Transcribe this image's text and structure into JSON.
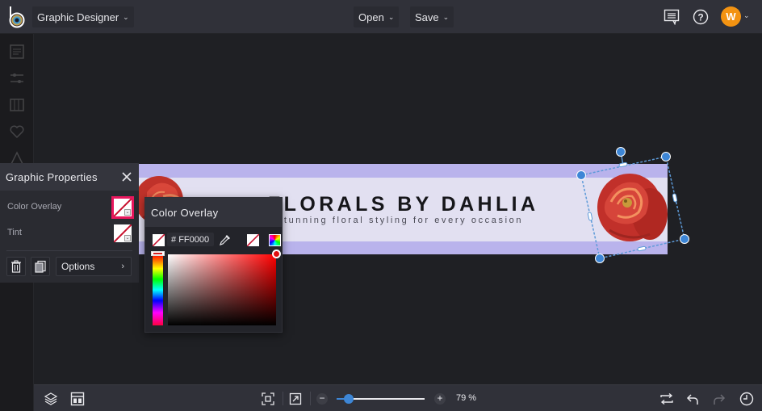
{
  "app": {
    "mode_label": "Graphic Designer",
    "open_label": "Open",
    "save_label": "Save",
    "user_initial": "W",
    "avatar_color": "#f39312"
  },
  "left_rail": {
    "icons": [
      "text-icon",
      "adjust-icon",
      "library-icon",
      "favorite-icon",
      "shape-icon"
    ]
  },
  "canvas": {
    "banner_title": "FLORALS BY DAHLIA",
    "banner_subtitle": "Stunning floral styling for every occasion",
    "banner_outer_color": "#b9b3ec",
    "banner_inner_color": "#e2e0f1"
  },
  "graphic_properties": {
    "title": "Graphic Properties",
    "color_overlay_label": "Color Overlay",
    "tint_label": "Tint",
    "options_label": "Options",
    "active_highlight": "#e8175d"
  },
  "color_overlay_panel": {
    "title": "Color Overlay",
    "hash": "#",
    "hex_value": "FF0000",
    "selected_color": "#ff0000"
  },
  "bottom_bar": {
    "zoom_percent": 79,
    "zoom_label": "79 %",
    "zoom_minus": "−",
    "zoom_plus": "+"
  },
  "accent_color": "#3d86d6"
}
